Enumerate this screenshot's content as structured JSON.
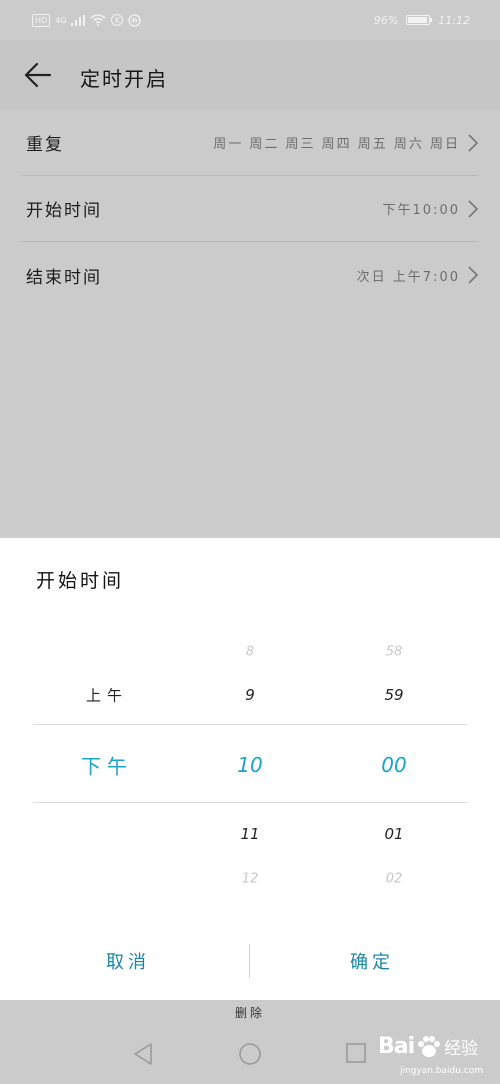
{
  "status_bar": {
    "hd_badge": "HD",
    "network": "4G",
    "k_badge": "K",
    "battery_text": "96%",
    "battery_level": 0.96,
    "time": "11:12"
  },
  "header": {
    "back_icon": "arrow-left-icon",
    "title": "定时开启"
  },
  "settings": {
    "rows": [
      {
        "label": "重复",
        "value": "周一 周二 周三 周四 周五 周六 周日"
      },
      {
        "label": "开始时间",
        "value": "下午10:00"
      },
      {
        "label": "结束时间",
        "value": "次日 上午7:00"
      }
    ]
  },
  "sheet": {
    "title": "开始时间",
    "picker": {
      "ampm": {
        "upper": "上午",
        "selected": "下午"
      },
      "hours": [
        "8",
        "9",
        "10",
        "11",
        "12"
      ],
      "minutes": [
        "58",
        "59",
        "00",
        "01",
        "02"
      ],
      "selected_index": 2
    },
    "cancel_label": "取消",
    "confirm_label": "确定"
  },
  "footer": {
    "delete_label": "删除"
  },
  "watermark": {
    "brand_a": "Bai",
    "brand_b": "经验",
    "url": "jingyan.baidu.com"
  },
  "colors": {
    "accent": "#1ca4c8",
    "button": "#1b86a6",
    "overlay_bg": "#cbcbcb",
    "sheet_bg": "#ffffff"
  },
  "icons": {
    "back": "arrow-left-icon",
    "chevron": "chevron-right-icon",
    "nav_back": "triangle-back-icon",
    "nav_home": "circle-home-icon",
    "nav_recent": "square-recent-icon"
  }
}
